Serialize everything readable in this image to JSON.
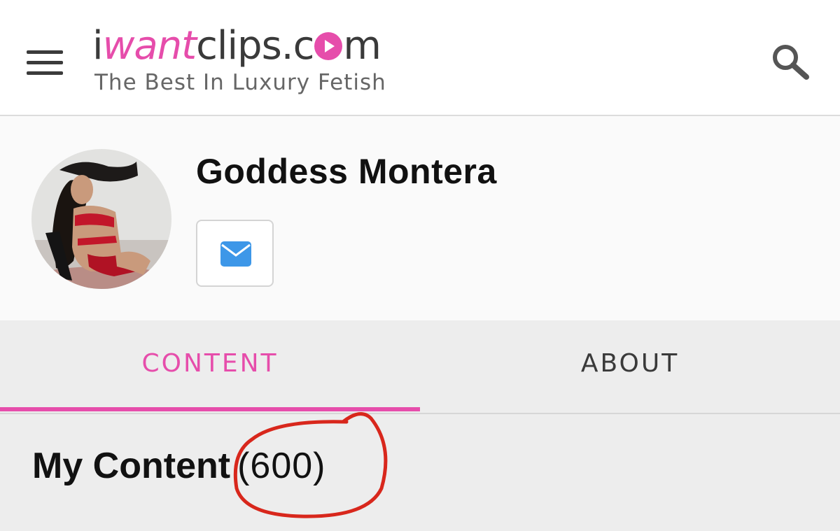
{
  "header": {
    "logo": {
      "part1": "i",
      "part2": "want",
      "part3": "clips.c",
      "part4": "m"
    },
    "tagline": "The Best In Luxury Fetish",
    "menu_icon": "hamburger-menu-icon",
    "search_icon": "search-icon"
  },
  "profile": {
    "name": "Goddess Montera",
    "message_icon": "envelope-icon"
  },
  "tabs": [
    {
      "label": "CONTENT",
      "active": true
    },
    {
      "label": "ABOUT",
      "active": false
    }
  ],
  "content": {
    "heading": "My Content",
    "count": "(600)"
  },
  "colors": {
    "accent": "#e64dab",
    "message_icon": "#3d97e8",
    "annotation": "#d8271c",
    "tab_bar_bg": "#ededed"
  }
}
